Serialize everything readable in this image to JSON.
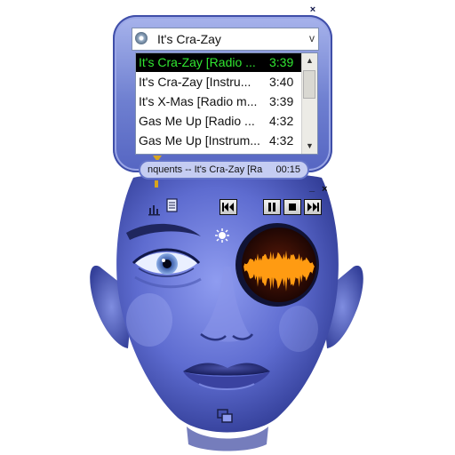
{
  "playlist": {
    "current": "It's Cra-Zay",
    "tracks": [
      {
        "title": "It's Cra-Zay [Radio ...",
        "duration": "3:39",
        "selected": true
      },
      {
        "title": "It's Cra-Zay [Instru...",
        "duration": "3:40",
        "selected": false
      },
      {
        "title": "It's X-Mas [Radio m...",
        "duration": "3:39",
        "selected": false
      },
      {
        "title": "Gas Me Up [Radio ...",
        "duration": "4:32",
        "selected": false
      },
      {
        "title": "Gas Me Up [Instrum...",
        "duration": "4:32",
        "selected": false
      }
    ]
  },
  "now_playing": {
    "marquee": "nquents -- It's Cra-Zay [Ra",
    "time": "00:15"
  },
  "glyphs": {
    "close": "×",
    "minimize": "_",
    "combo_arrow": "v",
    "scroll_up": "▲",
    "scroll_down": "▼"
  },
  "colors": {
    "skin_blue": "#6e7fd0",
    "selection_bg": "#000000",
    "selection_text": "#31e631",
    "visualizer_orange": "#ff9b12",
    "visualizer_bg": "#2a0d06"
  }
}
